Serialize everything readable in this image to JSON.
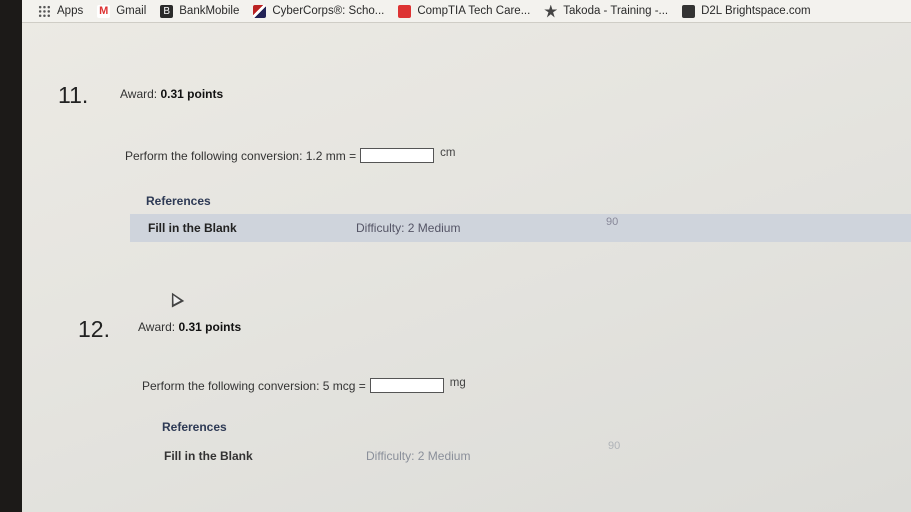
{
  "bookmarks": [
    {
      "label": "Apps",
      "icon": "apps-grid-icon"
    },
    {
      "label": "Gmail",
      "icon": "gmail-icon"
    },
    {
      "label": "BankMobile",
      "icon": "bankmobile-icon"
    },
    {
      "label": "CyberCorps®: Scho...",
      "icon": "cybercorps-icon"
    },
    {
      "label": "CompTIA Tech Care...",
      "icon": "comptia-icon"
    },
    {
      "label": "Takoda - Training -...",
      "icon": "takoda-icon"
    },
    {
      "label": "D2L Brightspace.com",
      "icon": "d2l-icon"
    }
  ],
  "questions": [
    {
      "number": "11.",
      "award_label": "Award:",
      "award_value": "0.31 points",
      "prompt": "Perform the following conversion: 1.2 mm =",
      "answer_value": "",
      "unit": "cm",
      "references_label": "References",
      "type": "Fill in the Blank",
      "difficulty": "Difficulty: 2 Medium",
      "score": "90"
    },
    {
      "number": "12.",
      "award_label": "Award:",
      "award_value": "0.31 points",
      "prompt": "Perform the following conversion: 5 mcg =",
      "answer_value": "",
      "unit": "mg",
      "references_label": "References",
      "type": "Fill in the Blank",
      "difficulty": "Difficulty: 2 Medium",
      "score": "90"
    }
  ]
}
